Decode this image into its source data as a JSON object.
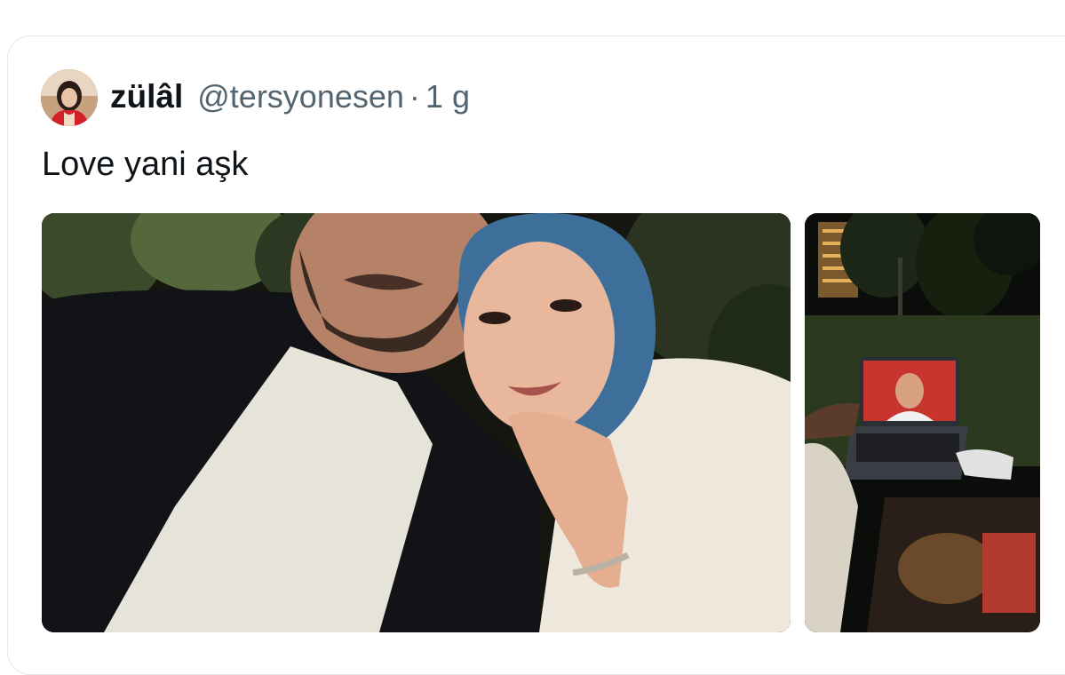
{
  "tweet": {
    "author_name": "zülâl",
    "handle": "@tersyonesen",
    "separator": "·",
    "time": "1 g",
    "text": "Love yani aşk"
  },
  "media": [
    {
      "icon": "photo-couple-selfie"
    },
    {
      "icon": "photo-laptop-in-park"
    }
  ],
  "colors": {
    "text_primary": "#0f1419",
    "text_secondary": "#536471",
    "card_border": "#e6e8ea"
  }
}
